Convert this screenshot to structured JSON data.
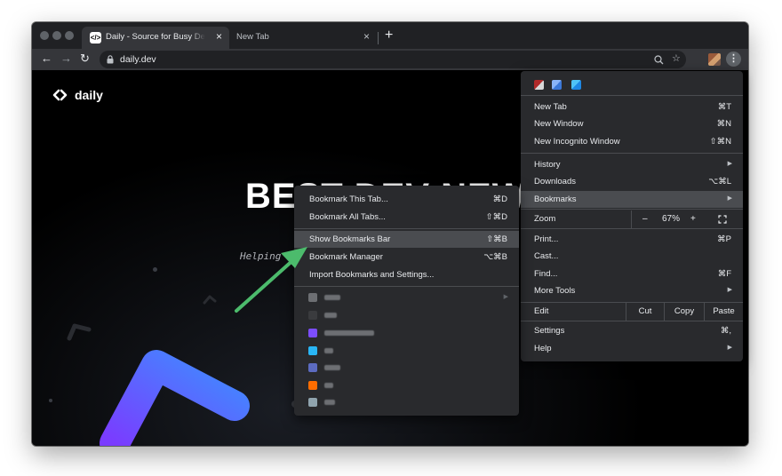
{
  "browser": {
    "tabs": [
      {
        "title": "Daily - Source for Busy Developers",
        "favicon": "daily-logo-icon",
        "active": true
      },
      {
        "title": "New Tab",
        "active": false
      }
    ],
    "url": "daily.dev",
    "new_tab_glyph": "+",
    "close_glyph": "×",
    "nav": {
      "back": "←",
      "forward": "→",
      "reload": "↻"
    },
    "icons": {
      "zoom": "⌕",
      "star": "☆",
      "lock": "🔒",
      "menu": "⋮"
    }
  },
  "page": {
    "logo_text": "daily",
    "hero_text": "BEST DEV NEWS",
    "subtitle": "Helping"
  },
  "main_menu": {
    "items": [
      {
        "label": "New Tab",
        "shortcut": "⌘T"
      },
      {
        "label": "New Window",
        "shortcut": "⌘N"
      },
      {
        "label": "New Incognito Window",
        "shortcut": "⇧⌘N"
      },
      {
        "label": "History",
        "submenu": true
      },
      {
        "label": "Downloads",
        "shortcut": "⌥⌘L"
      },
      {
        "label": "Bookmarks",
        "submenu": true,
        "highlighted": true
      },
      {
        "label": "Print...",
        "shortcut": "⌘P"
      },
      {
        "label": "Cast..."
      },
      {
        "label": "Find...",
        "shortcut": "⌘F"
      },
      {
        "label": "More Tools",
        "submenu": true
      },
      {
        "label": "Settings",
        "shortcut": "⌘,"
      },
      {
        "label": "Help",
        "submenu": true
      }
    ],
    "zoom": {
      "label": "Zoom",
      "minus": "–",
      "value": "67%",
      "plus": "+",
      "fullscreen": "⛶"
    },
    "edit": {
      "label": "Edit",
      "cut": "Cut",
      "copy": "Copy",
      "paste": "Paste"
    },
    "submenu_arrow": "▶"
  },
  "bookmarks_menu": {
    "items": [
      {
        "label": "Bookmark This Tab...",
        "shortcut": "⌘D"
      },
      {
        "label": "Bookmark All Tabs...",
        "shortcut": "⇧⌘D"
      },
      {
        "label": "Show Bookmarks Bar",
        "shortcut": "⇧⌘B",
        "highlighted": true
      },
      {
        "label": "Bookmark Manager",
        "shortcut": "⌥⌘B"
      },
      {
        "label": "Import Bookmarks and Settings..."
      }
    ],
    "submenu_arrow": "▶",
    "blurred_bookmark_colors": [
      "#6d6f73",
      "#3a3b3e",
      "#7c4dff",
      "#29b6f6",
      "#5c6bc0",
      "#ff6d00",
      "#90a4ae"
    ]
  },
  "colors": {
    "accent_green": "#4cbb6c",
    "brand_blue": "#4f6cff",
    "brand_purple": "#7a3cff"
  }
}
